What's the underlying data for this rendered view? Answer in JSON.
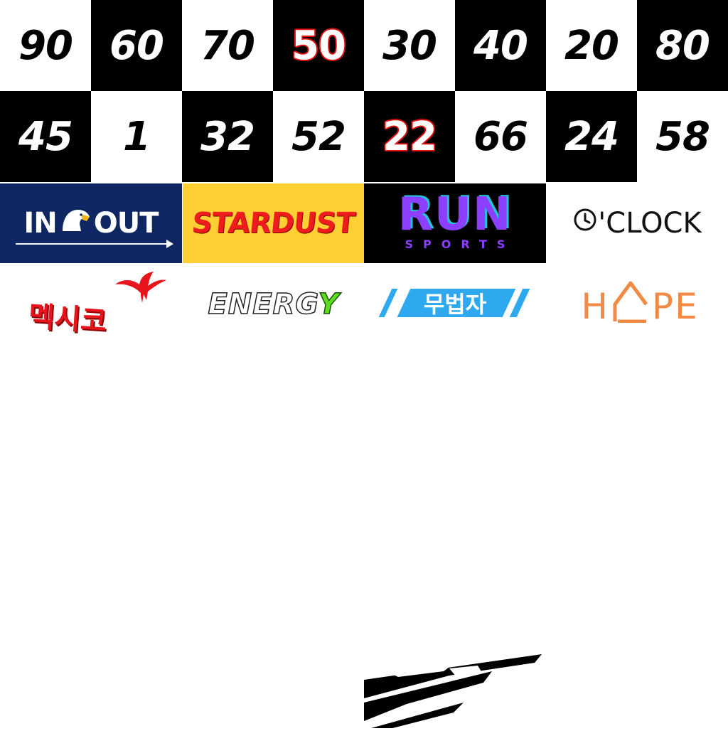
{
  "number_tiles": [
    {
      "value": "90",
      "style": "w",
      "red": false
    },
    {
      "value": "60",
      "style": "b",
      "red": false
    },
    {
      "value": "70",
      "style": "w",
      "red": false
    },
    {
      "value": "50",
      "style": "b",
      "red": true
    },
    {
      "value": "30",
      "style": "w",
      "red": false
    },
    {
      "value": "40",
      "style": "b",
      "red": false
    },
    {
      "value": "20",
      "style": "w",
      "red": false
    },
    {
      "value": "80",
      "style": "b",
      "red": false
    },
    {
      "value": "45",
      "style": "b",
      "red": false
    },
    {
      "value": "1",
      "style": "w",
      "red": false
    },
    {
      "value": "32",
      "style": "b",
      "red": false
    },
    {
      "value": "52",
      "style": "w",
      "red": false
    },
    {
      "value": "22",
      "style": "b",
      "red": true
    },
    {
      "value": "66",
      "style": "w",
      "red": false
    },
    {
      "value": "24",
      "style": "b",
      "red": false
    },
    {
      "value": "58",
      "style": "w",
      "red": false
    }
  ],
  "logos": {
    "inout": {
      "left": "IN",
      "right": "OUT",
      "bg": "#0e2762",
      "icon": "eagle-head-icon"
    },
    "stardust": {
      "text": "STARDUST",
      "bg": "#ffd033",
      "color": "#ee1c1c"
    },
    "run": {
      "big": "RUN",
      "small": "SPORTS",
      "color": "#8c3fff",
      "accent": "#22c3d8"
    },
    "oclock": {
      "text": "'CLOCK",
      "icon": "clock-icon"
    },
    "mexico": {
      "text": "멕시코",
      "color": "#e8141c",
      "icon": "eagle-icon"
    },
    "energy": {
      "text": "ENERG",
      "accent": "Y",
      "accent_color": "#5cdc1c"
    },
    "outlaw": {
      "text": "무법자",
      "color": "#2ea8ef"
    },
    "hope": {
      "h": "H",
      "pe": "PE",
      "color": "#f08a44",
      "icon": "house-roof-icon"
    }
  }
}
